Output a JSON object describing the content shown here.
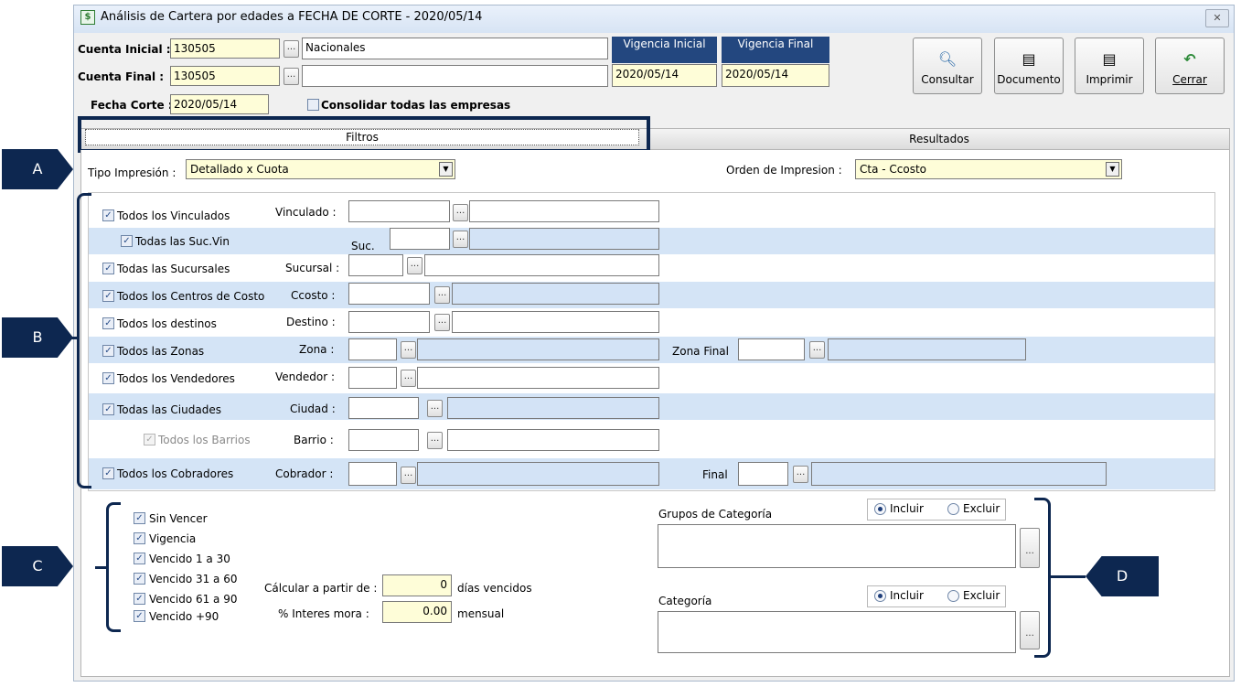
{
  "window": {
    "title": "Análisis de Cartera por edades a FECHA DE CORTE - 2020/05/14",
    "close_glyph": "✕"
  },
  "header": {
    "cuenta_inicial_label": "Cuenta Inicial :",
    "cuenta_inicial_value": "130505",
    "cuenta_inicial_name": "Nacionales",
    "cuenta_final_label": "Cuenta Final :",
    "cuenta_final_value": "130505",
    "cuenta_final_name": "",
    "fecha_corte_label": "Fecha Corte :",
    "fecha_corte_value": "2020/05/14",
    "consolidar_label": "Consolidar todas las empresas",
    "vigencia_inicial_label": "Vigencia Inicial",
    "vigencia_inicial_value": "2020/05/14",
    "vigencia_final_label": "Vigencia Final",
    "vigencia_final_value": "2020/05/14",
    "ellipsis": "..."
  },
  "toolbar": {
    "consultar": "Consultar",
    "documento": "Documento",
    "imprimir": "Imprimir",
    "cerrar": "Cerrar"
  },
  "tabs": {
    "filtros": "Filtros",
    "resultados": "Resultados"
  },
  "tipo": {
    "label": "Tipo Impresión :",
    "value": "Detallado x Cuota",
    "orden_label": "Orden de Impresion :",
    "orden_value": "Cta - Ccosto",
    "arrow": "▼"
  },
  "filters": {
    "vinculados": "Todos los Vinculados",
    "vinculado_lbl": "Vinculado :",
    "suc_vin": "Todas las Suc.Vin",
    "suc_lbl": "Suc.",
    "sucursales": "Todas las Sucursales",
    "sucursal_lbl": "Sucursal :",
    "centros": "Todos los Centros de Costo",
    "ccosto_lbl": "Ccosto :",
    "destinos": "Todos los destinos",
    "destino_lbl": "Destino :",
    "zonas": "Todos las Zonas",
    "zona_lbl": "Zona :",
    "zona_final_lbl": "Zona Final",
    "vendedores": "Todos los Vendedores",
    "vendedor_lbl": "Vendedor :",
    "ciudades": "Todas las Ciudades",
    "ciudad_lbl": "Ciudad :",
    "barrios": "Todos los Barrios",
    "barrio_lbl": "Barrio :",
    "cobradores": "Todos los Cobradores",
    "cobrador_lbl": "Cobrador :",
    "final_lbl": "Final",
    "check": "✓"
  },
  "aging": {
    "items": [
      "Sin Vencer",
      "Vigencia",
      "Vencido 1 a 30",
      "Vencido 31 a 60",
      "Vencido 61 a 90",
      "Vencido +90"
    ],
    "calcular_label": "Cálcular a partir de :",
    "calcular_value": "0",
    "calcular_unit": "días vencidos",
    "interes_label": "% Interes mora :",
    "interes_value": "0.00",
    "interes_unit": "mensual"
  },
  "categorias": {
    "grupos_label": "Grupos de Categoría",
    "categoria_label": "Categoría",
    "incluir": "Incluir",
    "excluir": "Excluir"
  },
  "callouts": {
    "a": "A",
    "b": "B",
    "c": "C",
    "d": "D"
  }
}
